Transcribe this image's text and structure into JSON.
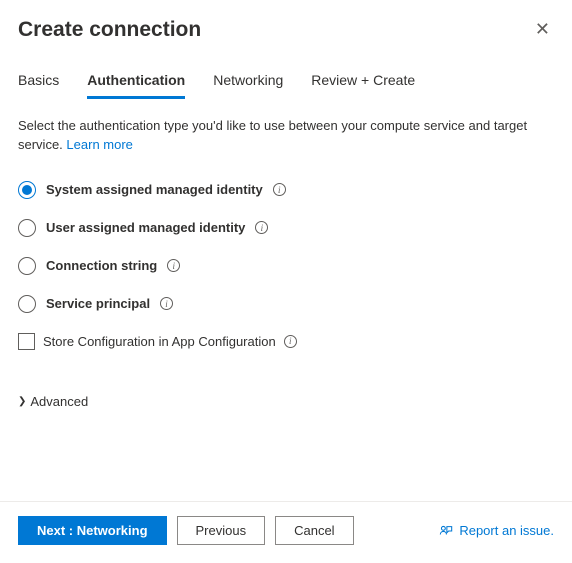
{
  "header": {
    "title": "Create connection"
  },
  "tabs": [
    {
      "label": "Basics",
      "active": false
    },
    {
      "label": "Authentication",
      "active": true
    },
    {
      "label": "Networking",
      "active": false
    },
    {
      "label": "Review + Create",
      "active": false
    }
  ],
  "description": {
    "text": "Select the authentication type you'd like to use between your compute service and target service.",
    "learn_more": "Learn more"
  },
  "auth_options": [
    {
      "label": "System assigned managed identity",
      "checked": true
    },
    {
      "label": "User assigned managed identity",
      "checked": false
    },
    {
      "label": "Connection string",
      "checked": false
    },
    {
      "label": "Service principal",
      "checked": false
    }
  ],
  "checkbox": {
    "label": "Store Configuration in App Configuration",
    "checked": false
  },
  "advanced": {
    "label": "Advanced"
  },
  "footer": {
    "next": "Next : Networking",
    "previous": "Previous",
    "cancel": "Cancel",
    "report": "Report an issue."
  }
}
